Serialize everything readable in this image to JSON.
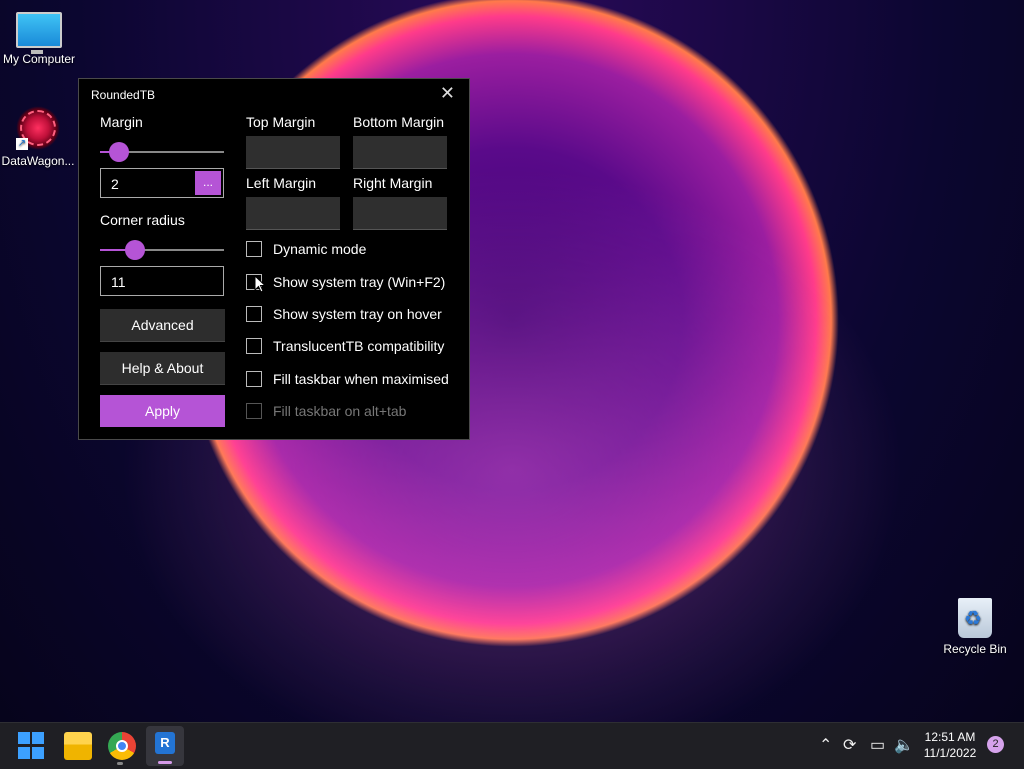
{
  "desktop": {
    "icons": [
      {
        "label": "My Computer",
        "icon": "monitor-icon"
      },
      {
        "label": "DataWagon...",
        "icon": "datawagon-icon"
      },
      {
        "label": "Recycle Bin",
        "icon": "recycle-bin-icon"
      }
    ]
  },
  "window": {
    "title": "RoundedTB",
    "close_icon": "close-icon",
    "margin_label": "Margin",
    "margin_value": "2",
    "margin_button_label": "...",
    "margin_slider_level": 0.15,
    "corner_radius_label": "Corner radius",
    "corner_radius_value": "11",
    "corner_radius_slider_level": 0.28,
    "top_margin_label": "Top Margin",
    "bottom_margin_label": "Bottom Margin",
    "left_margin_label": "Left Margin",
    "right_margin_label": "Right Margin",
    "advanced_label": "Advanced",
    "help_label": "Help & About",
    "apply_label": "Apply",
    "options": [
      {
        "label": "Dynamic mode",
        "checked": false,
        "enabled": true
      },
      {
        "label": "Show system tray (Win+F2)",
        "checked": false,
        "enabled": true
      },
      {
        "label": "Show system tray on hover",
        "checked": false,
        "enabled": true
      },
      {
        "label": "TranslucentTB compatibility",
        "checked": false,
        "enabled": true
      },
      {
        "label": "Fill taskbar when maximised",
        "checked": false,
        "enabled": true
      },
      {
        "label": "Fill taskbar on alt+tab",
        "checked": false,
        "enabled": false
      }
    ],
    "accent_color": "#b554d6"
  },
  "taskbar": {
    "apps": [
      "start-icon",
      "file-explorer-icon",
      "chrome-icon",
      "roundedtb-icon"
    ],
    "roundedtb_letter": "R",
    "tray_icons": [
      "chevron-up-icon",
      "sync-icon",
      "network-icon",
      "volume-icon"
    ],
    "time": "12:51 AM",
    "date": "11/1/2022",
    "notification_count": "2"
  }
}
